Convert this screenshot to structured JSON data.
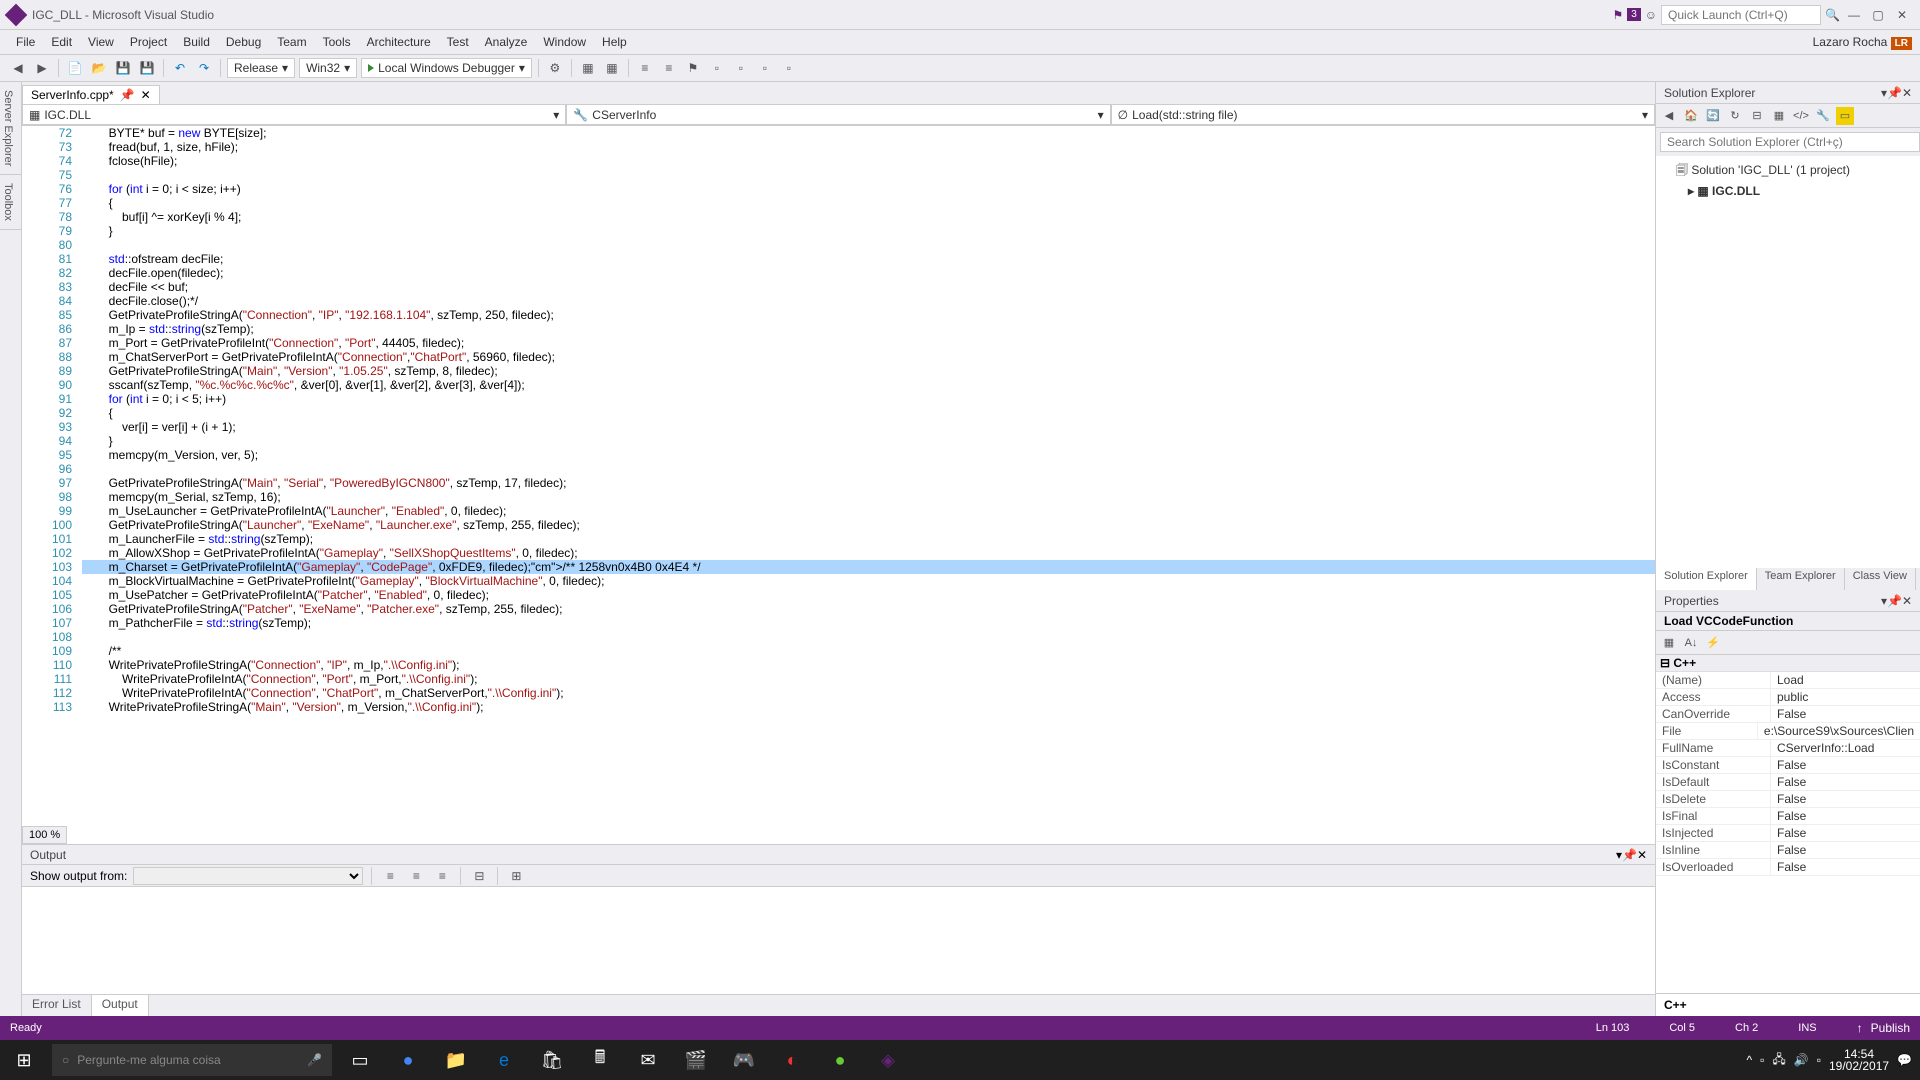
{
  "title": "IGC_DLL - Microsoft Visual Studio",
  "notify_badge": "3",
  "quicklaunch": "Quick Launch (Ctrl+Q)",
  "user_name": "Lazaro Rocha",
  "user_badge": "LR",
  "menu": [
    "File",
    "Edit",
    "View",
    "Project",
    "Build",
    "Debug",
    "Team",
    "Tools",
    "Architecture",
    "Test",
    "Analyze",
    "Window",
    "Help"
  ],
  "config": "Release",
  "platform": "Win32",
  "debugger_btn": "Local Windows Debugger",
  "tab_name": "ServerInfo.cpp*",
  "nav1": "IGC.DLL",
  "nav2": "CServerInfo",
  "nav3": "Load(std::string file)",
  "side_tabs": [
    "Server Explorer",
    "Toolbox"
  ],
  "zoom": "100 %",
  "code_lines": [
    {
      "n": 72,
      "t": "        BYTE* buf = new BYTE[size];"
    },
    {
      "n": 73,
      "t": "        fread(buf, 1, size, hFile);"
    },
    {
      "n": 74,
      "t": "        fclose(hFile);"
    },
    {
      "n": 75,
      "t": ""
    },
    {
      "n": 76,
      "t": "        for (int i = 0; i < size; i++)"
    },
    {
      "n": 77,
      "t": "        {"
    },
    {
      "n": 78,
      "t": "            buf[i] ^= xorKey[i % 4];"
    },
    {
      "n": 79,
      "t": "        }"
    },
    {
      "n": 80,
      "t": ""
    },
    {
      "n": 81,
      "t": "        std::ofstream decFile;"
    },
    {
      "n": 82,
      "t": "        decFile.open(filedec);"
    },
    {
      "n": 83,
      "t": "        decFile << buf;"
    },
    {
      "n": 84,
      "t": "        decFile.close();*/"
    },
    {
      "n": 85,
      "t": "        GetPrivateProfileStringA(\"Connection\", \"IP\", \"192.168.1.104\", szTemp, 250, filedec);",
      "m": true
    },
    {
      "n": 86,
      "t": "        m_Ip = std::string(szTemp);"
    },
    {
      "n": 87,
      "t": "        m_Port = GetPrivateProfileInt(\"Connection\", \"Port\", 44405, filedec);"
    },
    {
      "n": 88,
      "t": "        m_ChatServerPort = GetPrivateProfileIntA(\"Connection\",\"ChatPort\", 56960, filedec);"
    },
    {
      "n": 89,
      "t": "        GetPrivateProfileStringA(\"Main\", \"Version\", \"1.05.25\", szTemp, 8, filedec);"
    },
    {
      "n": 90,
      "t": "        sscanf(szTemp, \"%c.%c%c.%c%c\", &ver[0], &ver[1], &ver[2], &ver[3], &ver[4]);"
    },
    {
      "n": 91,
      "t": "        for (int i = 0; i < 5; i++)"
    },
    {
      "n": 92,
      "t": "        {"
    },
    {
      "n": 93,
      "t": "            ver[i] = ver[i] + (i + 1);"
    },
    {
      "n": 94,
      "t": "        }"
    },
    {
      "n": 95,
      "t": "        memcpy(m_Version, ver, 5);"
    },
    {
      "n": 96,
      "t": ""
    },
    {
      "n": 97,
      "t": "        GetPrivateProfileStringA(\"Main\", \"Serial\", \"PoweredByIGCN800\", szTemp, 17, filedec);"
    },
    {
      "n": 98,
      "t": "        memcpy(m_Serial, szTemp, 16);"
    },
    {
      "n": 99,
      "t": "        m_UseLauncher = GetPrivateProfileIntA(\"Launcher\", \"Enabled\", 0, filedec);"
    },
    {
      "n": 100,
      "t": "        GetPrivateProfileStringA(\"Launcher\", \"ExeName\", \"Launcher.exe\", szTemp, 255, filedec);"
    },
    {
      "n": 101,
      "t": "        m_LauncherFile = std::string(szTemp);"
    },
    {
      "n": 102,
      "t": "        m_AllowXShop = GetPrivateProfileIntA(\"Gameplay\", \"SellXShopQuestItems\", 0, filedec);"
    },
    {
      "n": 103,
      "t": "        m_Charset = GetPrivateProfileIntA(\"Gameplay\", \"CodePage\", 0xFDE9, filedec);/** 1258vn0x4B0 0x4E4 */",
      "hl": true
    },
    {
      "n": 104,
      "t": "        m_BlockVirtualMachine = GetPrivateProfileInt(\"Gameplay\", \"BlockVirtualMachine\", 0, filedec);"
    },
    {
      "n": 105,
      "t": "        m_UsePatcher = GetPrivateProfileIntA(\"Patcher\", \"Enabled\", 0, filedec);"
    },
    {
      "n": 106,
      "t": "        GetPrivateProfileStringA(\"Patcher\", \"ExeName\", \"Patcher.exe\", szTemp, 255, filedec);"
    },
    {
      "n": 107,
      "t": "        m_PathcherFile = std::string(szTemp);"
    },
    {
      "n": 108,
      "t": ""
    },
    {
      "n": 109,
      "t": "        /**"
    },
    {
      "n": 110,
      "t": "        WritePrivateProfileStringA(\"Connection\", \"IP\", m_Ip,\".\\\\Config.ini\");"
    },
    {
      "n": 111,
      "t": "            WritePrivateProfileIntA(\"Connection\", \"Port\", m_Port,\".\\\\Config.ini\");"
    },
    {
      "n": 112,
      "t": "            WritePrivateProfileIntA(\"Connection\", \"ChatPort\", m_ChatServerPort,\".\\\\Config.ini\");"
    },
    {
      "n": 113,
      "t": "        WritePrivateProfileStringA(\"Main\", \"Version\", m_Version,\".\\\\Config.ini\");"
    }
  ],
  "output": {
    "title": "Output",
    "show_from": "Show output from:",
    "tabs": [
      "Error List",
      "Output"
    ],
    "active_tab": 1
  },
  "sln_explorer": {
    "title": "Solution Explorer",
    "search": "Search Solution Explorer (Ctrl+ç)",
    "root": "Solution 'IGC_DLL' (1 project)",
    "project": "IGC.DLL",
    "tabs": [
      "Solution Explorer",
      "Team Explorer",
      "Class View"
    ]
  },
  "properties": {
    "title": "Properties",
    "header": "Load VCCodeFunction",
    "category": "C++",
    "rows": [
      {
        "k": "(Name)",
        "v": "Load"
      },
      {
        "k": "Access",
        "v": "public"
      },
      {
        "k": "CanOverride",
        "v": "False"
      },
      {
        "k": "File",
        "v": "e:\\SourceS9\\xSources\\Clien"
      },
      {
        "k": "FullName",
        "v": "CServerInfo::Load"
      },
      {
        "k": "IsConstant",
        "v": "False"
      },
      {
        "k": "IsDefault",
        "v": "False"
      },
      {
        "k": "IsDelete",
        "v": "False"
      },
      {
        "k": "IsFinal",
        "v": "False"
      },
      {
        "k": "IsInjected",
        "v": "False"
      },
      {
        "k": "IsInline",
        "v": "False"
      },
      {
        "k": "IsOverloaded",
        "v": "False"
      }
    ],
    "footer": "C++"
  },
  "status": {
    "ready": "Ready",
    "ln": "Ln 103",
    "col": "Col 5",
    "ch": "Ch 2",
    "ins": "INS",
    "publish": "Publish"
  },
  "taskbar": {
    "search": "Pergunte-me alguma coisa",
    "time": "14:54",
    "date": "19/02/2017"
  }
}
